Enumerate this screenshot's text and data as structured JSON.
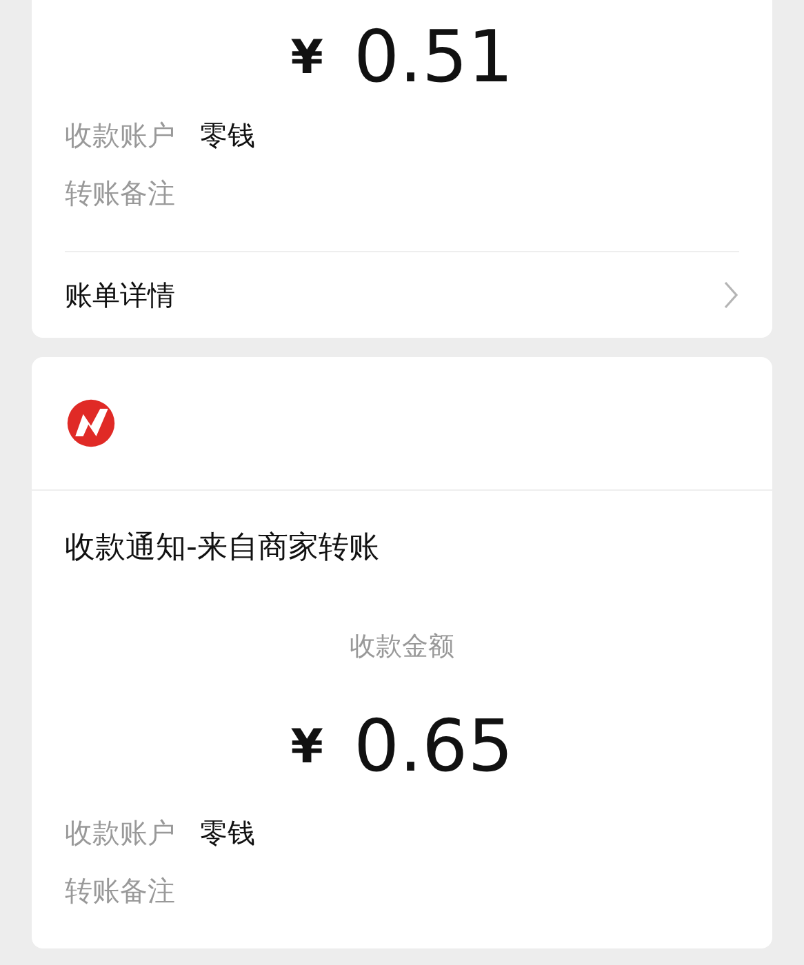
{
  "receipts": [
    {
      "amount": {
        "currency": "¥",
        "value": "0.51"
      },
      "fields": [
        {
          "label": "收款账户",
          "value": "零钱"
        },
        {
          "label": "转账备注"
        }
      ],
      "link": "账单详情"
    },
    {
      "kind": "notice",
      "title": "收款通知-来自商家转账",
      "amount_label": "收款金额",
      "amount": {
        "currency": "¥",
        "value": "0.65"
      },
      "fields": [
        {
          "label": "收款账户",
          "value": "零钱"
        },
        {
          "label": "转账备注"
        }
      ]
    }
  ]
}
